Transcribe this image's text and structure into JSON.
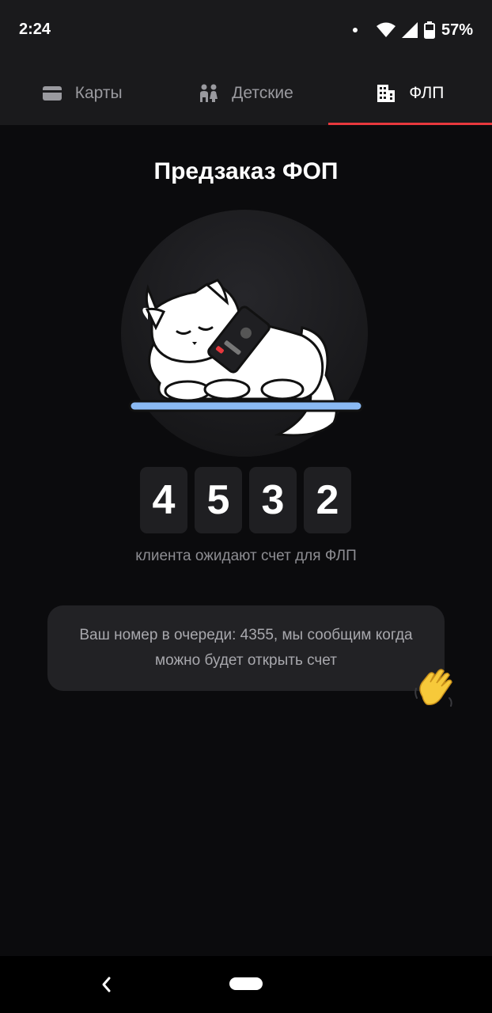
{
  "status_bar": {
    "time": "2:24",
    "battery": "57%"
  },
  "tabs": [
    {
      "label": "Карты",
      "icon": "card-icon",
      "active": false
    },
    {
      "label": "Детские",
      "icon": "children-icon",
      "active": false
    },
    {
      "label": "ФЛП",
      "icon": "building-icon",
      "active": true
    }
  ],
  "title": "Предзаказ ФОП",
  "counter": {
    "digits": [
      "4",
      "5",
      "3",
      "2"
    ],
    "caption": "клиента ожидают счет для ФЛП"
  },
  "queue": {
    "text": "Ваш номер в очереди: 4355, мы сообщим когда можно будет открыть счет"
  },
  "colors": {
    "accent": "#e8383d",
    "background": "#0b0b0d",
    "card": "#222225"
  }
}
